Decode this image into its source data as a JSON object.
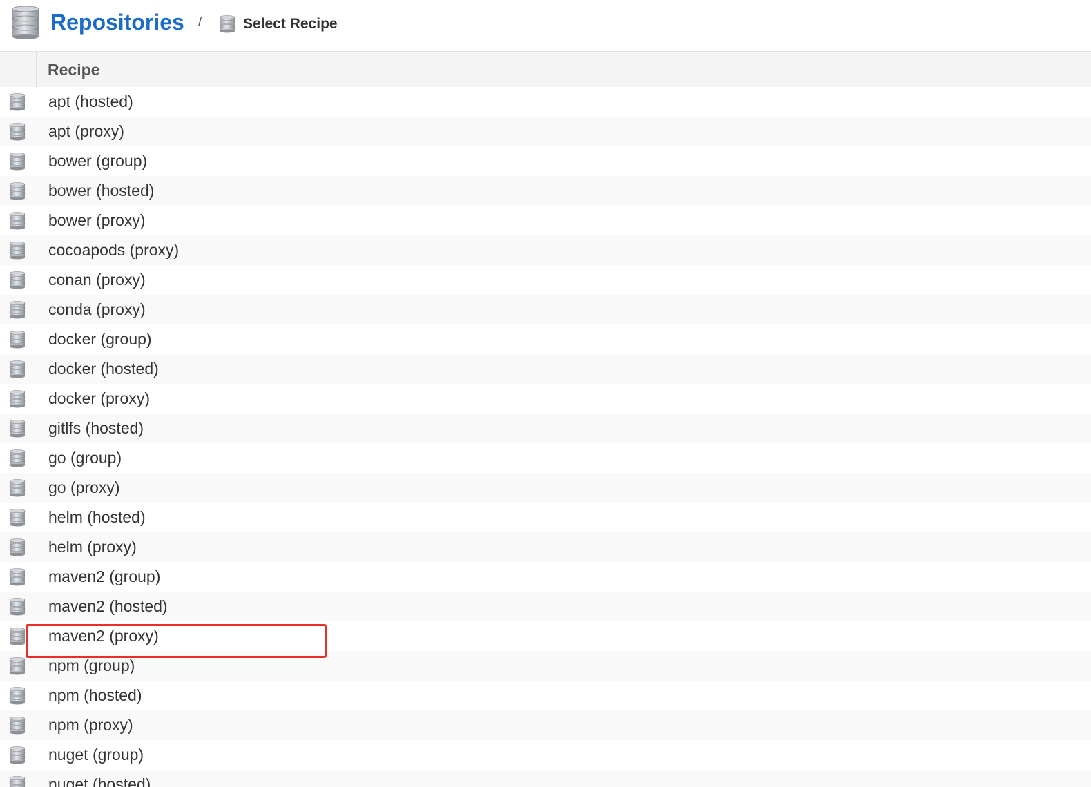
{
  "header": {
    "title": "Repositories",
    "separator": "/",
    "breadcrumb": "Select Recipe",
    "title_icon": "database-icon",
    "breadcrumb_icon": "database-icon"
  },
  "table": {
    "column_header": "Recipe",
    "sort_icon": "sort-ascending-arrow-icon",
    "row_icon": "database-icon",
    "rows": [
      "apt (hosted)",
      "apt (proxy)",
      "bower (group)",
      "bower (hosted)",
      "bower (proxy)",
      "cocoapods (proxy)",
      "conan (proxy)",
      "conda (proxy)",
      "docker (group)",
      "docker (hosted)",
      "docker (proxy)",
      "gitlfs (hosted)",
      "go (group)",
      "go (proxy)",
      "helm (hosted)",
      "helm (proxy)",
      "maven2 (group)",
      "maven2 (hosted)",
      "maven2 (proxy)",
      "npm (group)",
      "npm (hosted)",
      "npm (proxy)",
      "nuget (group)",
      "nuget (hosted)"
    ]
  },
  "annotation": {
    "highlighted_row": "maven2 (proxy)",
    "color": "#e8302a"
  }
}
